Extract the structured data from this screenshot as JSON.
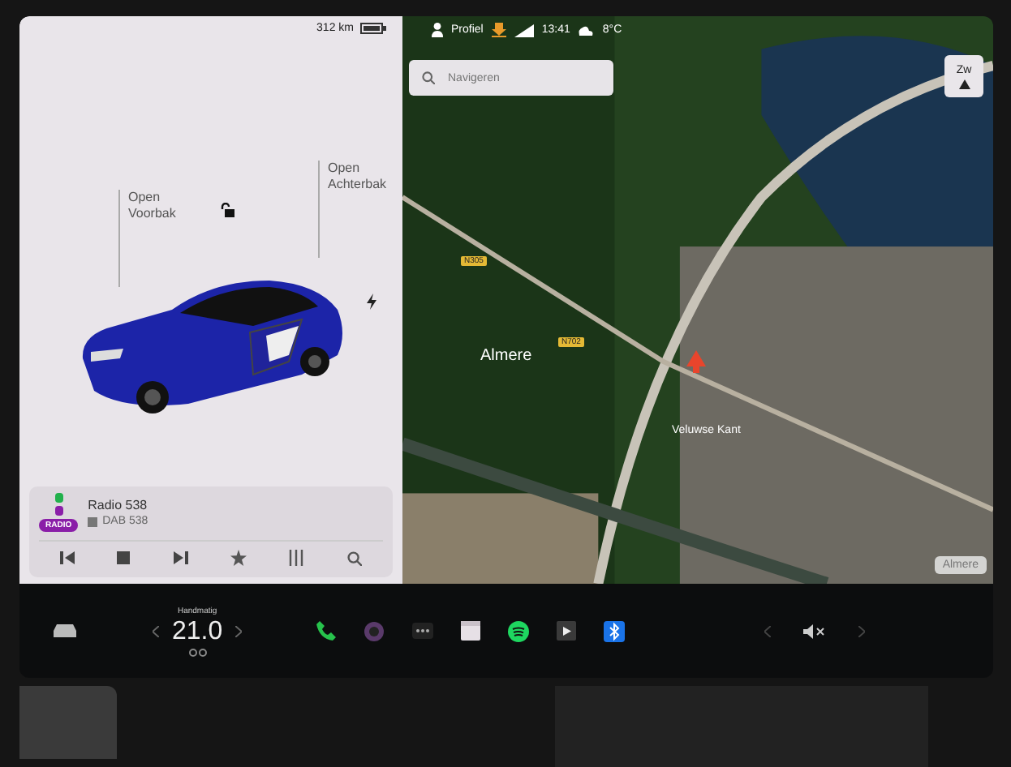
{
  "car_panel": {
    "range": "312 km",
    "trunk_labels": [
      {
        "action": "Open",
        "part": "Voorbak"
      },
      {
        "action": "Open",
        "part": "Achterbak"
      }
    ]
  },
  "media": {
    "station": "Radio 538",
    "source_badge": "RADIO",
    "subtitle": "DAB 538"
  },
  "map": {
    "status": {
      "profile": "Profiel",
      "time": "13:41",
      "temperature": "8°C"
    },
    "search": {
      "placeholder": "Navigeren"
    },
    "compass": "Zw",
    "place_labels": [
      "Almere",
      "Veluwse Kant"
    ],
    "road_shields": [
      "N305",
      "N702"
    ],
    "corner_label": "Almere"
  },
  "bottom_bar": {
    "climate": {
      "mode": "Handmatig",
      "temperature": "21.0"
    }
  }
}
